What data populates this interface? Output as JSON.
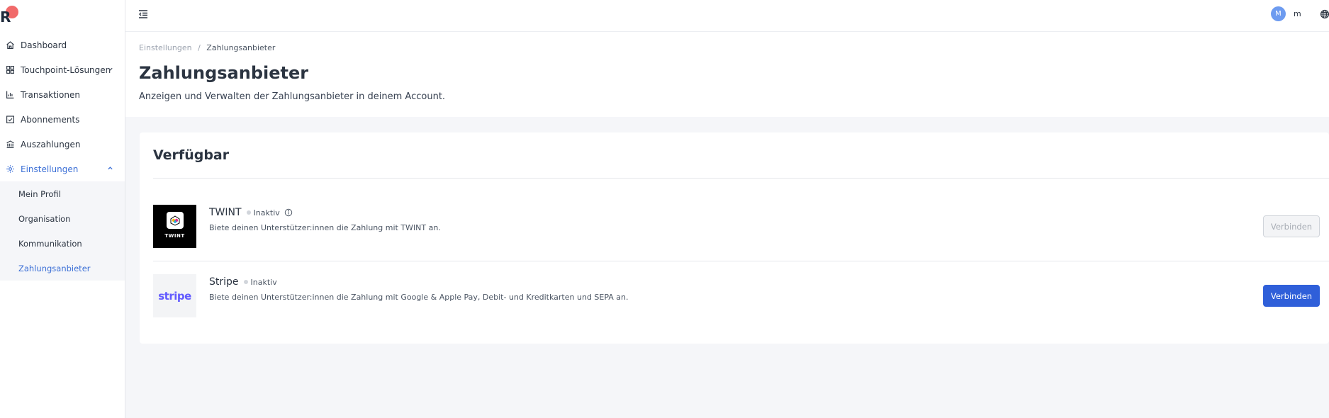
{
  "app": {
    "logo_letter": "R"
  },
  "sidebar": {
    "items": [
      {
        "label": "Dashboard",
        "icon": "home-icon"
      },
      {
        "label": "Touchpoint-Lösungen",
        "icon": "grid-icon"
      },
      {
        "label": "Transaktionen",
        "icon": "bar-chart-icon"
      },
      {
        "label": "Abonnements",
        "icon": "calendar-check-icon"
      },
      {
        "label": "Auszahlungen",
        "icon": "bank-icon"
      },
      {
        "label": "Einstellungen",
        "icon": "gear-icon"
      }
    ],
    "sub_items": [
      {
        "label": "Mein Profil"
      },
      {
        "label": "Organisation"
      },
      {
        "label": "Kommunikation"
      },
      {
        "label": "Zahlungsanbieter"
      }
    ]
  },
  "topbar": {
    "avatar_initial": "M",
    "username": "m"
  },
  "breadcrumb": {
    "parent": "Einstellungen",
    "separator": "/",
    "current": "Zahlungsanbieter"
  },
  "page": {
    "title": "Zahlungsanbieter",
    "subtitle": "Anzeigen und Verwalten der Zahlungsanbieter in deinem Account."
  },
  "section": {
    "title": "Verfügbar"
  },
  "providers": [
    {
      "name": "TWINT",
      "logo_text": "TWINT",
      "status": "Inaktiv",
      "description": "Biete deinen Unterstützer:innen die Zahlung mit TWINT an.",
      "button": "Verbinden"
    },
    {
      "name": "Stripe",
      "logo_text": "stripe",
      "status": "Inaktiv",
      "description": "Biete deinen Unterstützer:innen die Zahlung mit Google & Apple Pay, Debit- und Kreditkarten und SEPA an.",
      "button": "Verbinden"
    }
  ],
  "colors": {
    "accent": "#2f5fd9",
    "active_nav": "#3b6fd6",
    "stripe": "#635bff"
  }
}
